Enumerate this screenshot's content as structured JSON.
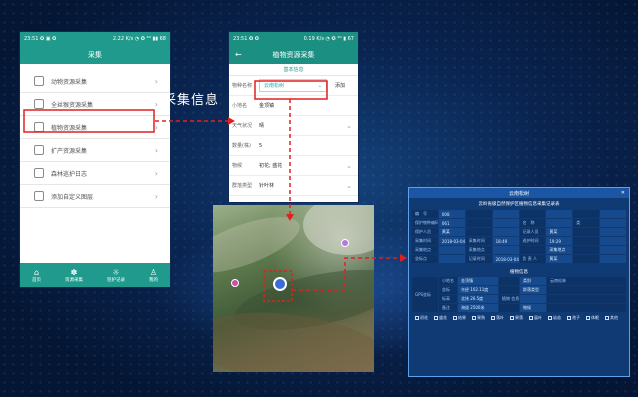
{
  "caption": "采集信息",
  "phone1": {
    "status_left": "23:51 ✪ ▣ ✪",
    "status_right": "2.22 K/s ◔ ✪ ⁴ᴳ ▮▮ 68",
    "title": "采集",
    "menu": [
      {
        "label": "动物资源采集",
        "icon": "animal-icon"
      },
      {
        "label": "全丝猴资源采集",
        "icon": "monkey-icon"
      },
      {
        "label": "植物资源采集",
        "icon": "plant-icon"
      },
      {
        "label": "扩产资源采集",
        "icon": "resource-icon"
      },
      {
        "label": "森林巡护日志",
        "icon": "log-icon"
      },
      {
        "label": "添加自定义图层",
        "icon": "add-layer-icon"
      }
    ],
    "tabs": [
      {
        "label": "首页",
        "icon": "home-icon"
      },
      {
        "label": "资源采集",
        "icon": "collect-icon"
      },
      {
        "label": "巡护记录",
        "icon": "patrol-icon"
      },
      {
        "label": "我的",
        "icon": "user-icon"
      }
    ]
  },
  "phone2": {
    "status_left": "23:51 ✪ ✪",
    "status_right": "0.19 K/s ◔ ✪ ⁴ᴳ ▮ 67",
    "title": "植物资源采集",
    "back": "←",
    "section": "基本信息",
    "species_label": "物种名称",
    "species_value": "云南松树",
    "add_label": "添加",
    "fields": [
      {
        "label": "小地名",
        "value": "金顶镇",
        "dropdown": false
      },
      {
        "label": "天气状况",
        "value": "晴",
        "dropdown": true
      },
      {
        "label": "数量(株)",
        "value": "5",
        "dropdown": false
      },
      {
        "label": "物候",
        "value": "初花; 盛花",
        "dropdown": true
      },
      {
        "label": "群落类型",
        "value": "针叶林",
        "dropdown": true
      }
    ]
  },
  "panel": {
    "title": "云南松树",
    "subtitle": "云岭省级自然保护区植物信息采集记录表",
    "rows": [
      [
        "编　号",
        "008",
        "",
        "",
        "",
        "",
        "",
        ""
      ],
      [
        "保护物种编码",
        "061",
        "",
        "",
        "名　称",
        "",
        "类",
        ""
      ],
      [
        "保护人员",
        "黄某",
        "",
        "",
        "记录人员",
        "黄某",
        "",
        ""
      ],
      [
        "采集时间",
        "2018-03-04",
        "采集时间",
        "18:49",
        "巡护时间",
        "19:29",
        "",
        ""
      ],
      [
        "采集地点",
        "",
        "采集地点",
        "",
        "",
        "采集地点",
        "",
        ""
      ],
      [
        "坐标点",
        "",
        "记录时间",
        "2018-03-04",
        "负 责 人",
        "黄某",
        "",
        ""
      ]
    ],
    "detail_header": "植物信息",
    "gps": "GPS坐标",
    "sub_rows": [
      [
        "小地名",
        "金顶镇",
        "",
        "类别",
        "云南松林"
      ],
      [
        "坐标",
        "东经 102.11度",
        "",
        "群落类型",
        ""
      ],
      [
        "标高",
        "北纬 26.5度",
        "植物\n信息",
        "",
        ""
      ],
      [
        "备注",
        "海拔 2500米",
        "",
        "物候",
        ""
      ]
    ],
    "checks": [
      "初花",
      "盛花",
      "结果",
      "果熟",
      "落叶",
      "果落",
      "展叶",
      "幼苗",
      "孢子",
      "休眠",
      "其他"
    ]
  }
}
